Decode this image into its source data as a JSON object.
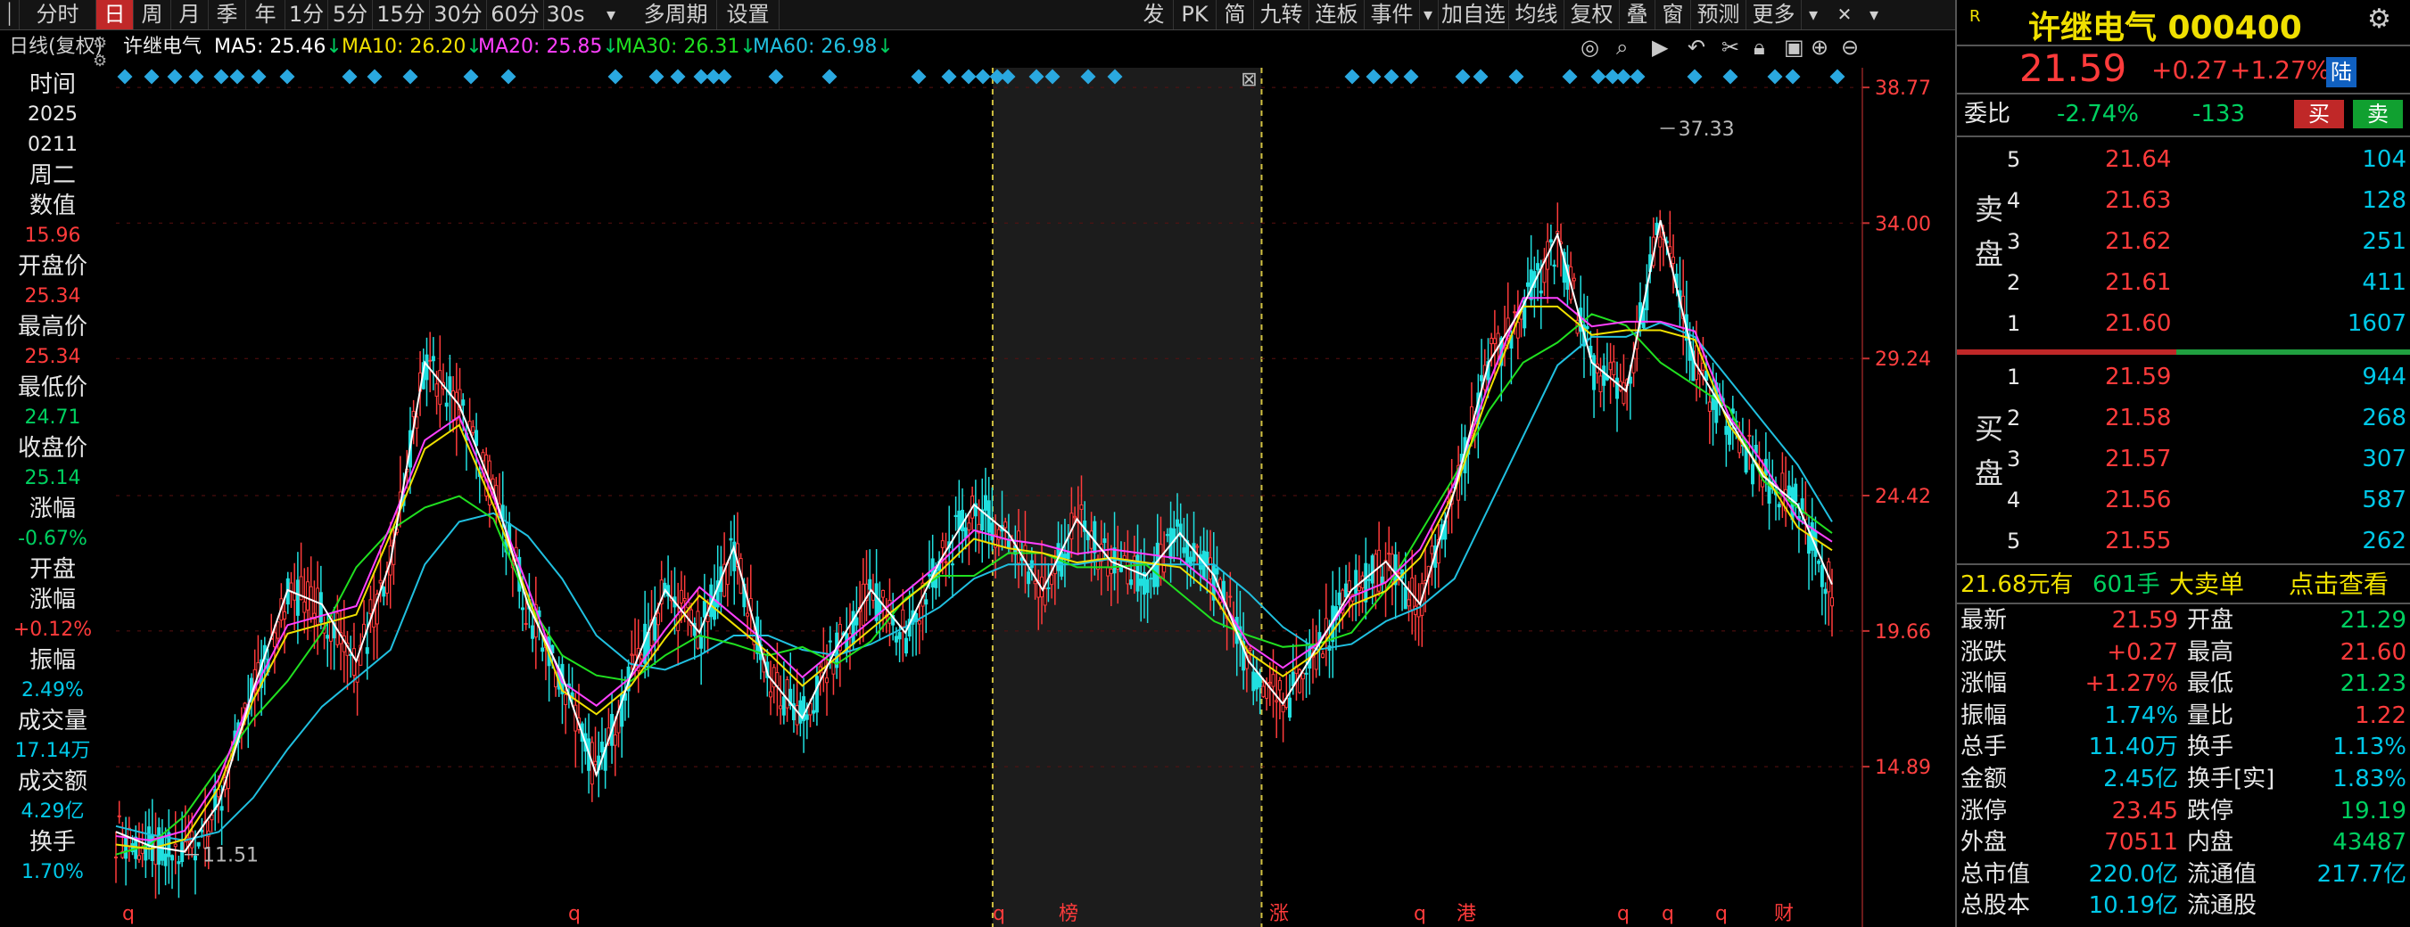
{
  "toolbar": {
    "periods": [
      "分时",
      "日",
      "周",
      "月",
      "季",
      "年",
      "1分",
      "5分",
      "15分",
      "30分",
      "60分",
      "30s"
    ],
    "active_period": "日",
    "multi_period": "多周期",
    "settings": "设置",
    "right_items": [
      "发",
      "PK",
      "简",
      "九转",
      "连板",
      "事件"
    ],
    "right_items2": [
      "加自选",
      "均线",
      "复权",
      "叠",
      "窗",
      "预测",
      "更多"
    ]
  },
  "infobar": {
    "chart_label": "日线(复权)",
    "stock_name": "许继电气",
    "ma5": "MA5: 25.46",
    "ma10": "MA10: 26.20",
    "ma20": "MA20: 25.85",
    "ma30": "MA30: 26.31",
    "ma60": "MA60: 26.98",
    "down_arrow": "↓"
  },
  "leftpanel": {
    "time_label": "时间",
    "year": "2025",
    "date": "0211",
    "weekday": "周二",
    "value_label": "数值",
    "value": "15.96",
    "open_label": "开盘价",
    "open": "25.34",
    "high_label": "最高价",
    "high": "25.34",
    "low_label": "最低价",
    "low": "24.71",
    "close_label": "收盘价",
    "close": "25.14",
    "change_label": "涨幅",
    "change": "-0.67%",
    "open_change_label1": "开盘",
    "open_change_label2": "涨幅",
    "open_change": "+0.12%",
    "amplitude_label": "振幅",
    "amplitude": "2.49%",
    "volume_label": "成交量",
    "volume": "17.14万",
    "amount_label": "成交额",
    "amount": "4.29亿",
    "turnover_label": "换手",
    "turnover": "1.70%"
  },
  "chart_data": {
    "type": "line",
    "title": "许继电气 日线(复权)",
    "y_ticks": [
      "38.77",
      "34.00",
      "29.24",
      "24.42",
      "19.66",
      "14.89"
    ],
    "ylim": [
      10.13,
      38.77
    ],
    "high_label": "37.33",
    "low_label": "11.51",
    "bottom_markers": [
      "q",
      "q",
      "q",
      "榜",
      "涨",
      "q",
      "港",
      "q",
      "q",
      "q",
      "财"
    ],
    "series": [
      {
        "name": "MA5",
        "color": "#ffffff"
      },
      {
        "name": "MA10",
        "color": "#f0e000"
      },
      {
        "name": "MA20",
        "color": "#ff40ff"
      },
      {
        "name": "MA30",
        "color": "#20e020"
      },
      {
        "name": "MA60",
        "color": "#20c0e0"
      }
    ],
    "x": [
      0,
      10,
      20,
      30,
      40,
      50,
      60,
      70,
      80,
      90,
      100,
      110,
      120,
      130,
      140,
      150,
      160,
      170,
      180,
      190,
      200,
      210,
      220,
      230,
      240,
      250,
      260,
      270,
      280,
      290,
      300,
      310,
      320,
      330,
      340,
      350,
      360,
      370,
      380,
      390,
      400,
      410,
      420,
      430,
      440,
      450,
      460,
      470,
      480,
      490,
      500
    ],
    "close": [
      12.5,
      12.0,
      11.8,
      13.5,
      17.5,
      21.0,
      20.5,
      18.5,
      22.0,
      29.0,
      27.5,
      24.5,
      20.5,
      18.0,
      14.5,
      18.0,
      21.0,
      19.5,
      22.5,
      18.0,
      16.5,
      19.0,
      21.0,
      19.5,
      22.0,
      24.0,
      23.0,
      21.0,
      23.5,
      22.0,
      21.5,
      23.0,
      21.5,
      18.5,
      17.0,
      19.0,
      21.0,
      22.0,
      20.5,
      24.5,
      29.0,
      31.0,
      33.5,
      29.0,
      28.0,
      34.0,
      29.0,
      27.0,
      25.0,
      24.0,
      21.2
    ],
    "ma_long": [
      12.8,
      12.5,
      12.3,
      12.6,
      13.8,
      15.5,
      17.0,
      18.0,
      19.0,
      22.0,
      23.5,
      23.8,
      23.0,
      21.5,
      19.5,
      18.5,
      18.3,
      18.8,
      19.5,
      19.5,
      19.0,
      18.8,
      19.2,
      19.8,
      20.5,
      21.5,
      22.0,
      22.0,
      22.0,
      22.2,
      22.0,
      22.0,
      22.0,
      21.0,
      19.8,
      19.0,
      19.2,
      20.0,
      20.5,
      21.5,
      24.0,
      26.5,
      29.0,
      30.0,
      30.0,
      30.5,
      30.0,
      28.5,
      27.0,
      25.5,
      23.5
    ]
  },
  "rightpanel": {
    "r_badge": "R",
    "stock_title": "许继电气 000400",
    "price": "21.59",
    "change": "+0.27",
    "change_pct": "+1.27%",
    "market": "陆",
    "weibi_label": "委比",
    "weibi": "-2.74%",
    "weicha": "-133",
    "buy_btn": "买",
    "sell_btn": "卖",
    "sell_label": "卖盘",
    "buy_label": "买盘",
    "asks": [
      {
        "level": "5",
        "price": "21.64",
        "vol": "104"
      },
      {
        "level": "4",
        "price": "21.63",
        "vol": "128"
      },
      {
        "level": "3",
        "price": "21.62",
        "vol": "251"
      },
      {
        "level": "2",
        "price": "21.61",
        "vol": "411"
      },
      {
        "level": "1",
        "price": "21.60",
        "vol": "1607"
      }
    ],
    "bids": [
      {
        "level": "1",
        "price": "21.59",
        "vol": "944"
      },
      {
        "level": "2",
        "price": "21.58",
        "vol": "268"
      },
      {
        "level": "3",
        "price": "21.57",
        "vol": "307"
      },
      {
        "level": "4",
        "price": "21.56",
        "vol": "587"
      },
      {
        "level": "5",
        "price": "21.55",
        "vol": "262"
      }
    ],
    "big_order_price": "21.68元有",
    "big_order_vol": "601手",
    "big_order_label": "大卖单",
    "big_order_link": "点击查看",
    "stats": [
      {
        "l1": "最新",
        "v1": "21.59",
        "c1": "red",
        "l2": "开盘",
        "v2": "21.29",
        "c2": "green"
      },
      {
        "l1": "涨跌",
        "v1": "+0.27",
        "c1": "red",
        "l2": "最高",
        "v2": "21.60",
        "c2": "red"
      },
      {
        "l1": "涨幅",
        "v1": "+1.27%",
        "c1": "red",
        "l2": "最低",
        "v2": "21.23",
        "c2": "green"
      },
      {
        "l1": "振幅",
        "v1": "1.74%",
        "c1": "cyan",
        "l2": "量比",
        "v2": "1.22",
        "c2": "red"
      },
      {
        "l1": "总手",
        "v1": "11.40万",
        "c1": "cyan",
        "l2": "换手",
        "v2": "1.13%",
        "c2": "cyan"
      },
      {
        "l1": "金额",
        "v1": "2.45亿",
        "c1": "cyan",
        "l2": "换手[实]",
        "v2": "1.83%",
        "c2": "cyan"
      },
      {
        "l1": "涨停",
        "v1": "23.45",
        "c1": "red",
        "l2": "跌停",
        "v2": "19.19",
        "c2": "green"
      },
      {
        "l1": "外盘",
        "v1": "70511",
        "c1": "red",
        "l2": "内盘",
        "v2": "43487",
        "c2": "green"
      },
      {
        "l1": "总市值",
        "v1": "220.0亿",
        "c1": "cyan",
        "l2": "流通值",
        "v2": "217.7亿",
        "c2": "cyan"
      },
      {
        "l1": "总股本",
        "v1": "10.19亿",
        "c1": "cyan",
        "l2": "流通股",
        "v2": "",
        "c2": "cyan"
      }
    ]
  },
  "colors": {
    "up": "#ff3b3b",
    "down": "#00d060",
    "accent": "#c02828",
    "axis_text": "#ff4040",
    "highlight_bg": "#1c1c1c"
  }
}
